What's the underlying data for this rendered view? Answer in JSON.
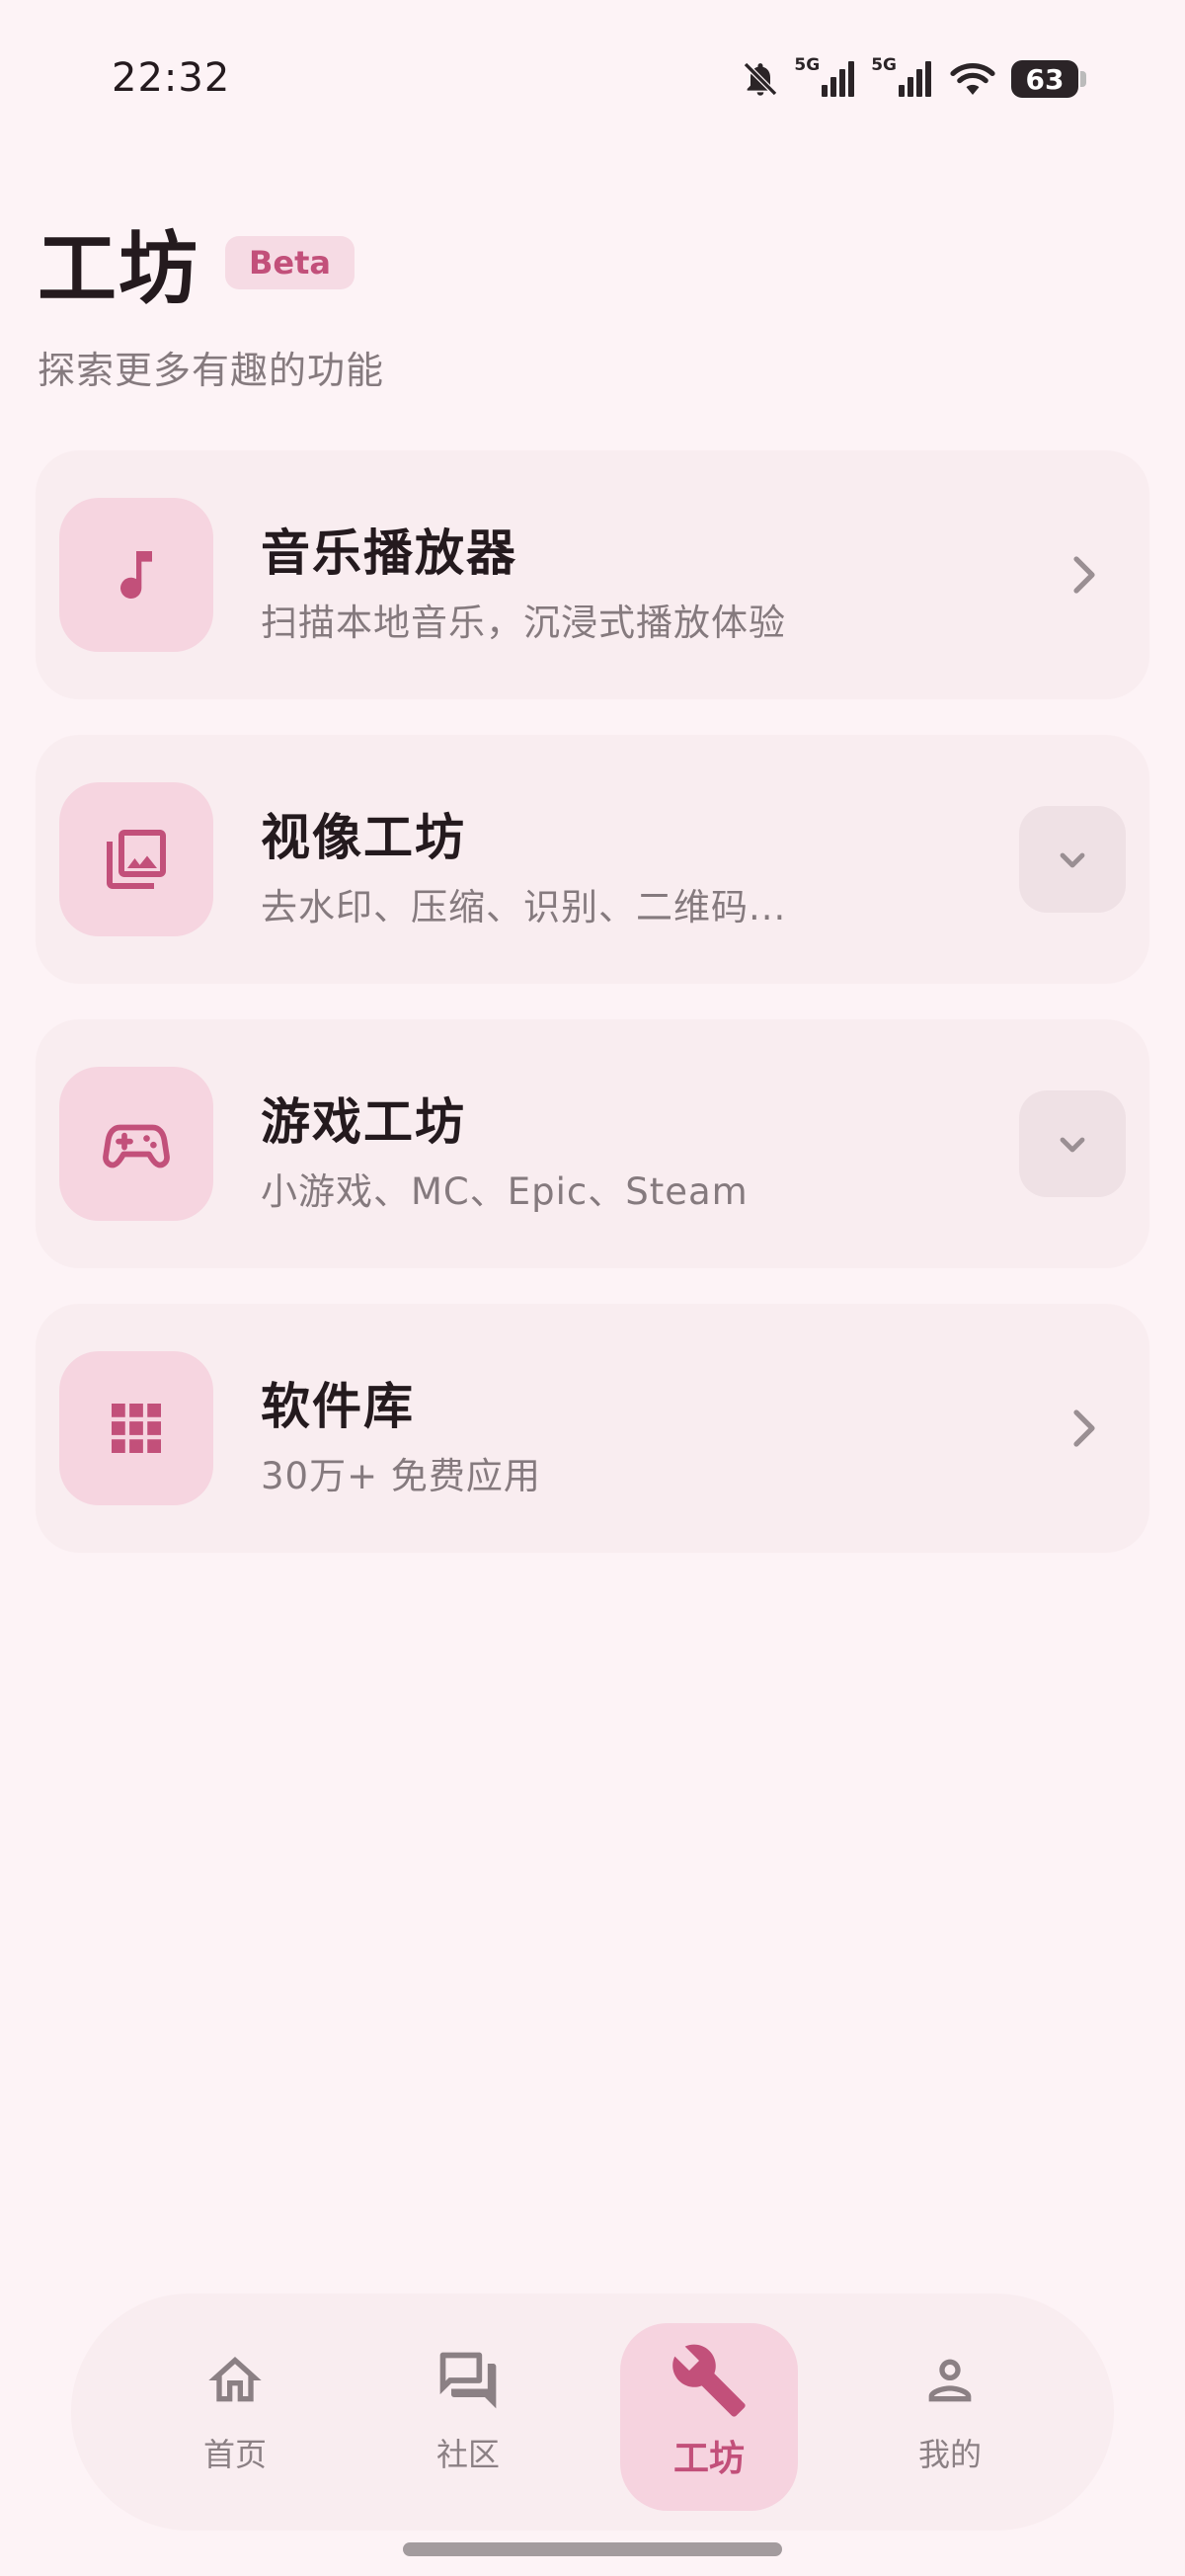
{
  "status_bar": {
    "time": "22:32",
    "network_1": "5G",
    "network_2": "5G",
    "battery": "63",
    "icons": [
      "bell-off-icon",
      "signal-icon",
      "signal-icon",
      "wifi-icon",
      "battery-icon"
    ]
  },
  "header": {
    "title": "工坊",
    "badge": "Beta",
    "subtitle": "探索更多有趣的功能"
  },
  "cards": [
    {
      "title": "音乐播放器",
      "description": "扫描本地音乐，沉浸式播放体验",
      "icon": "music-note-icon",
      "action": "chevron-right-icon"
    },
    {
      "title": "视像工坊",
      "description": "去水印、压缩、识别、二维码...",
      "icon": "photo-library-icon",
      "action": "expand-icon"
    },
    {
      "title": "游戏工坊",
      "description": "小游戏、MC、Epic、Steam",
      "icon": "gamepad-icon",
      "action": "expand-icon"
    },
    {
      "title": "软件库",
      "description": "30万+ 免费应用",
      "icon": "app-grid-icon",
      "action": "chevron-right-icon"
    }
  ],
  "bottom_nav": {
    "active": "工坊",
    "items": [
      {
        "label": "首页",
        "icon": "home-icon"
      },
      {
        "label": "社区",
        "icon": "forum-icon"
      },
      {
        "label": "工坊",
        "icon": "wrench-icon"
      },
      {
        "label": "我的",
        "icon": "person-icon"
      }
    ]
  },
  "colors": {
    "background": "#fdf3f6",
    "card": "#f9edf0",
    "accent": "#c2507a",
    "icon_tile": "#f6d5e0",
    "muted_text": "#857a7e"
  }
}
